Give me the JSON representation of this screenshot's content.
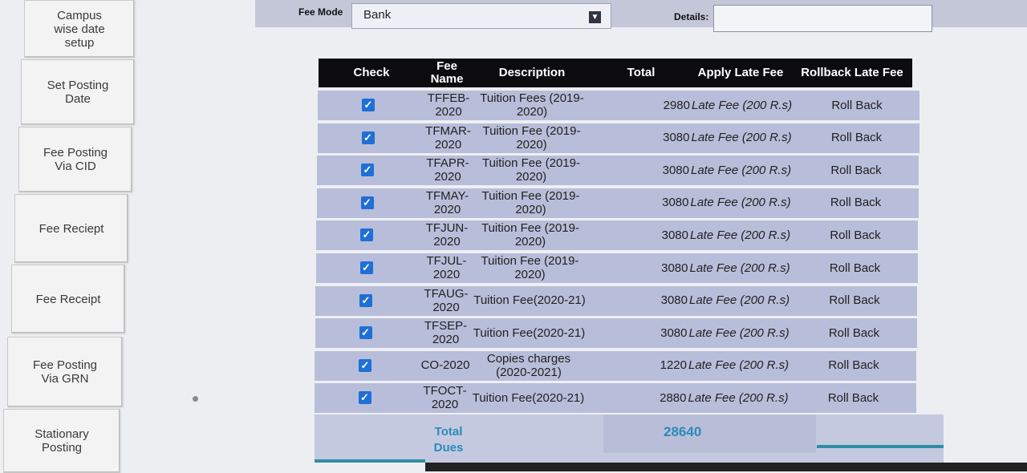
{
  "sidebar": {
    "items": [
      {
        "label": "Campus wise date setup"
      },
      {
        "label": "Set Posting Date"
      },
      {
        "label": "Fee Posting Via CID"
      },
      {
        "label": "Fee Reciept"
      },
      {
        "label": "Fee Receipt"
      },
      {
        "label": "Fee Posting Via GRN"
      },
      {
        "label": "Stationary Posting"
      }
    ]
  },
  "filter": {
    "fee_mode_label": "Fee Mode",
    "fee_mode_value": "Bank",
    "details_label": "Details:",
    "details_value": ""
  },
  "grid": {
    "headers": {
      "check": "Check",
      "fee_name": "Fee Name",
      "description": "Description",
      "total": "Total",
      "apply_late_fee": "Apply Late Fee",
      "rollback_late_fee": "Rollback Late Fee"
    },
    "rows": [
      {
        "fee_name": "TFFEB-2020",
        "description": "Tuition Fees (2019-2020)",
        "total": "2980",
        "late_fee": "Late Fee (200 R.s)",
        "rollback": "Roll Back",
        "checked": true
      },
      {
        "fee_name": "TFMAR-2020",
        "description": "Tuition Fee (2019-2020)",
        "total": "3080",
        "late_fee": "Late Fee (200 R.s)",
        "rollback": "Roll Back",
        "checked": true
      },
      {
        "fee_name": "TFAPR-2020",
        "description": "Tuition Fee (2019-2020)",
        "total": "3080",
        "late_fee": "Late Fee (200 R.s)",
        "rollback": "Roll Back",
        "checked": true
      },
      {
        "fee_name": "TFMAY-2020",
        "description": "Tuition Fee (2019-2020)",
        "total": "3080",
        "late_fee": "Late Fee (200 R.s)",
        "rollback": "Roll Back",
        "checked": true
      },
      {
        "fee_name": "TFJUN-2020",
        "description": "Tuition Fee (2019-2020)",
        "total": "3080",
        "late_fee": "Late Fee (200 R.s)",
        "rollback": "Roll Back",
        "checked": true
      },
      {
        "fee_name": "TFJUL-2020",
        "description": "Tuition Fee (2019-2020)",
        "total": "3080",
        "late_fee": "Late Fee (200 R.s)",
        "rollback": "Roll Back",
        "checked": true
      },
      {
        "fee_name": "TFAUG-2020",
        "description": "Tuition Fee(2020-21)",
        "total": "3080",
        "late_fee": "Late Fee (200 R.s)",
        "rollback": "Roll Back",
        "checked": true
      },
      {
        "fee_name": "TFSEP-2020",
        "description": "Tuition Fee(2020-21)",
        "total": "3080",
        "late_fee": "Late Fee (200 R.s)",
        "rollback": "Roll Back",
        "checked": true
      },
      {
        "fee_name": "CO-2020",
        "description": "Copies charges (2020-2021)",
        "total": "1220",
        "late_fee": "Late Fee (200 R.s)",
        "rollback": "Roll Back",
        "checked": true
      },
      {
        "fee_name": "TFOCT-2020",
        "description": "Tuition Fee(2020-21)",
        "total": "2880",
        "late_fee": "Late Fee (200 R.s)",
        "rollback": "Roll Back",
        "checked": true
      }
    ],
    "total_dues_label": "Total Dues",
    "total_dues_value": "28640"
  },
  "colors": {
    "header_bg": "#0c0c0e",
    "row_bg": "#b8bdd9",
    "checkbox": "#1f6fd6",
    "total_text": "#2a8bb8",
    "filter_bar": "#c3c7d8"
  },
  "icons": {
    "checkbox": "check-icon",
    "dropdown": "chevron-down-icon"
  }
}
